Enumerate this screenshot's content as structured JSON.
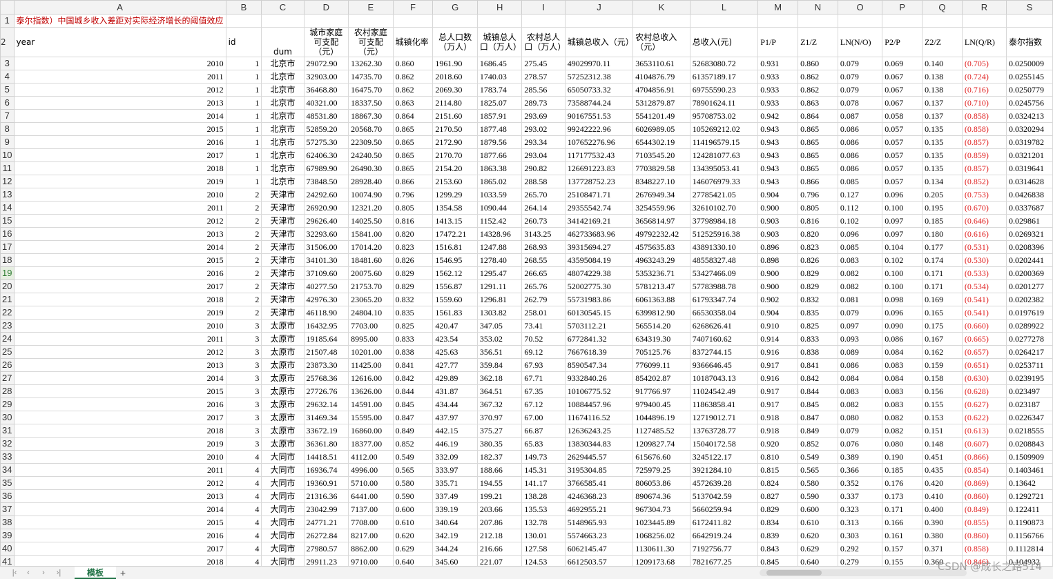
{
  "columns": [
    "A",
    "B",
    "C",
    "D",
    "E",
    "F",
    "G",
    "H",
    "I",
    "J",
    "K",
    "L",
    "M",
    "N",
    "O",
    "P",
    "Q",
    "R",
    "S"
  ],
  "title": "泰尔指数）中国城乡收入差距对实际经济增长的阈值效应",
  "headers": [
    "year",
    "id",
    "dum",
    "城市家庭可支配（元）",
    "农村家庭可支配（元）",
    "城镇化率",
    "总人口数（万人）",
    "城镇总人口（万人）",
    "农村总人口（万人）",
    "城镇总收入（元）",
    "农村总收入（元）",
    "总收入(元)",
    "P1/P",
    "Z1/Z",
    "LN(N/O)",
    "P2/P",
    "Z2/Z",
    "LN(Q/R)",
    "泰尔指数"
  ],
  "rows": [
    [
      "2010",
      "1",
      "北京市",
      "29072.90",
      "13262.30",
      "0.860",
      "1961.90",
      "1686.45",
      "275.45",
      "49029970.11",
      "3653110.61",
      "52683080.72",
      "0.931",
      "0.860",
      "0.079",
      "0.069",
      "0.140",
      "(0.705)",
      "0.0250009"
    ],
    [
      "2011",
      "1",
      "北京市",
      "32903.00",
      "14735.70",
      "0.862",
      "2018.60",
      "1740.03",
      "278.57",
      "57252312.38",
      "4104876.79",
      "61357189.17",
      "0.933",
      "0.862",
      "0.079",
      "0.067",
      "0.138",
      "(0.724)",
      "0.0255145"
    ],
    [
      "2012",
      "1",
      "北京市",
      "36468.80",
      "16475.70",
      "0.862",
      "2069.30",
      "1783.74",
      "285.56",
      "65050733.32",
      "4704856.91",
      "69755590.23",
      "0.933",
      "0.862",
      "0.079",
      "0.067",
      "0.138",
      "(0.716)",
      "0.0250779"
    ],
    [
      "2013",
      "1",
      "北京市",
      "40321.00",
      "18337.50",
      "0.863",
      "2114.80",
      "1825.07",
      "289.73",
      "73588744.24",
      "5312879.87",
      "78901624.11",
      "0.933",
      "0.863",
      "0.078",
      "0.067",
      "0.137",
      "(0.710)",
      "0.0245756"
    ],
    [
      "2014",
      "1",
      "北京市",
      "48531.80",
      "18867.30",
      "0.864",
      "2151.60",
      "1857.91",
      "293.69",
      "90167551.53",
      "5541201.49",
      "95708753.02",
      "0.942",
      "0.864",
      "0.087",
      "0.058",
      "0.137",
      "(0.858)",
      "0.0324213"
    ],
    [
      "2015",
      "1",
      "北京市",
      "52859.20",
      "20568.70",
      "0.865",
      "2170.50",
      "1877.48",
      "293.02",
      "99242222.96",
      "6026989.05",
      "105269212.02",
      "0.943",
      "0.865",
      "0.086",
      "0.057",
      "0.135",
      "(0.858)",
      "0.0320294"
    ],
    [
      "2016",
      "1",
      "北京市",
      "57275.30",
      "22309.50",
      "0.865",
      "2172.90",
      "1879.56",
      "293.34",
      "107652276.96",
      "6544302.19",
      "114196579.15",
      "0.943",
      "0.865",
      "0.086",
      "0.057",
      "0.135",
      "(0.857)",
      "0.0319782"
    ],
    [
      "2017",
      "1",
      "北京市",
      "62406.30",
      "24240.50",
      "0.865",
      "2170.70",
      "1877.66",
      "293.04",
      "117177532.43",
      "7103545.20",
      "124281077.63",
      "0.943",
      "0.865",
      "0.086",
      "0.057",
      "0.135",
      "(0.859)",
      "0.0321201"
    ],
    [
      "2018",
      "1",
      "北京市",
      "67989.90",
      "26490.30",
      "0.865",
      "2154.20",
      "1863.38",
      "290.82",
      "126691223.83",
      "7703829.58",
      "134395053.41",
      "0.943",
      "0.865",
      "0.086",
      "0.057",
      "0.135",
      "(0.857)",
      "0.0319641"
    ],
    [
      "2019",
      "1",
      "北京市",
      "73848.50",
      "28928.40",
      "0.866",
      "2153.60",
      "1865.02",
      "288.58",
      "137728752.23",
      "8348227.10",
      "146076979.33",
      "0.943",
      "0.866",
      "0.085",
      "0.057",
      "0.134",
      "(0.852)",
      "0.0314628"
    ],
    [
      "2010",
      "2",
      "天津市",
      "24292.60",
      "10074.90",
      "0.796",
      "1299.29",
      "1033.59",
      "265.70",
      "25108471.71",
      "2676949.34",
      "27785421.05",
      "0.904",
      "0.796",
      "0.127",
      "0.096",
      "0.205",
      "(0.753)",
      "0.0426838"
    ],
    [
      "2011",
      "2",
      "天津市",
      "26920.90",
      "12321.20",
      "0.805",
      "1354.58",
      "1090.44",
      "264.14",
      "29355542.74",
      "3254559.96",
      "32610102.70",
      "0.900",
      "0.805",
      "0.112",
      "0.100",
      "0.195",
      "(0.670)",
      "0.0337687"
    ],
    [
      "2012",
      "2",
      "天津市",
      "29626.40",
      "14025.50",
      "0.816",
      "1413.15",
      "1152.42",
      "260.73",
      "34142169.21",
      "3656814.97",
      "37798984.18",
      "0.903",
      "0.816",
      "0.102",
      "0.097",
      "0.185",
      "(0.646)",
      "0.029861"
    ],
    [
      "2013",
      "2",
      "天津市",
      "32293.60",
      "15841.00",
      "0.820",
      "17472.21",
      "14328.96",
      "3143.25",
      "462733683.96",
      "49792232.42",
      "512525916.38",
      "0.903",
      "0.820",
      "0.096",
      "0.097",
      "0.180",
      "(0.616)",
      "0.0269321"
    ],
    [
      "2014",
      "2",
      "天津市",
      "31506.00",
      "17014.20",
      "0.823",
      "1516.81",
      "1247.88",
      "268.93",
      "39315694.27",
      "4575635.83",
      "43891330.10",
      "0.896",
      "0.823",
      "0.085",
      "0.104",
      "0.177",
      "(0.531)",
      "0.0208396"
    ],
    [
      "2015",
      "2",
      "天津市",
      "34101.30",
      "18481.60",
      "0.826",
      "1546.95",
      "1278.40",
      "268.55",
      "43595084.19",
      "4963243.29",
      "48558327.48",
      "0.898",
      "0.826",
      "0.083",
      "0.102",
      "0.174",
      "(0.530)",
      "0.0202441"
    ],
    [
      "2016",
      "2",
      "天津市",
      "37109.60",
      "20075.60",
      "0.829",
      "1562.12",
      "1295.47",
      "266.65",
      "48074229.38",
      "5353236.71",
      "53427466.09",
      "0.900",
      "0.829",
      "0.082",
      "0.100",
      "0.171",
      "(0.533)",
      "0.0200369"
    ],
    [
      "2017",
      "2",
      "天津市",
      "40277.50",
      "21753.70",
      "0.829",
      "1556.87",
      "1291.11",
      "265.76",
      "52002775.30",
      "5781213.47",
      "57783988.78",
      "0.900",
      "0.829",
      "0.082",
      "0.100",
      "0.171",
      "(0.534)",
      "0.0201277"
    ],
    [
      "2018",
      "2",
      "天津市",
      "42976.30",
      "23065.20",
      "0.832",
      "1559.60",
      "1296.81",
      "262.79",
      "55731983.86",
      "6061363.88",
      "61793347.74",
      "0.902",
      "0.832",
      "0.081",
      "0.098",
      "0.169",
      "(0.541)",
      "0.0202382"
    ],
    [
      "2019",
      "2",
      "天津市",
      "46118.90",
      "24804.10",
      "0.835",
      "1561.83",
      "1303.82",
      "258.01",
      "60130545.15",
      "6399812.90",
      "66530358.04",
      "0.904",
      "0.835",
      "0.079",
      "0.096",
      "0.165",
      "(0.541)",
      "0.0197619"
    ],
    [
      "2010",
      "3",
      "太原市",
      "16432.95",
      "7703.00",
      "0.825",
      "420.47",
      "347.05",
      "73.41",
      "5703112.21",
      "565514.20",
      "6268626.41",
      "0.910",
      "0.825",
      "0.097",
      "0.090",
      "0.175",
      "(0.660)",
      "0.0289922"
    ],
    [
      "2011",
      "3",
      "太原市",
      "19185.64",
      "8995.00",
      "0.833",
      "423.54",
      "353.02",
      "70.52",
      "6772841.32",
      "634319.30",
      "7407160.62",
      "0.914",
      "0.833",
      "0.093",
      "0.086",
      "0.167",
      "(0.665)",
      "0.0277278"
    ],
    [
      "2012",
      "3",
      "太原市",
      "21507.48",
      "10201.00",
      "0.838",
      "425.63",
      "356.51",
      "69.12",
      "7667618.39",
      "705125.76",
      "8372744.15",
      "0.916",
      "0.838",
      "0.089",
      "0.084",
      "0.162",
      "(0.657)",
      "0.0264217"
    ],
    [
      "2013",
      "3",
      "太原市",
      "23873.30",
      "11425.00",
      "0.841",
      "427.77",
      "359.84",
      "67.93",
      "8590547.34",
      "776099.11",
      "9366646.45",
      "0.917",
      "0.841",
      "0.086",
      "0.083",
      "0.159",
      "(0.651)",
      "0.0253711"
    ],
    [
      "2014",
      "3",
      "太原市",
      "25768.36",
      "12616.00",
      "0.842",
      "429.89",
      "362.18",
      "67.71",
      "9332840.26",
      "854202.87",
      "10187043.13",
      "0.916",
      "0.842",
      "0.084",
      "0.084",
      "0.158",
      "(0.630)",
      "0.0239195"
    ],
    [
      "2015",
      "3",
      "太原市",
      "27726.76",
      "13626.00",
      "0.844",
      "431.87",
      "364.51",
      "67.35",
      "10106775.52",
      "917766.97",
      "11024542.49",
      "0.917",
      "0.844",
      "0.083",
      "0.083",
      "0.156",
      "(0.628)",
      "0.023497"
    ],
    [
      "2016",
      "3",
      "太原市",
      "29632.14",
      "14591.00",
      "0.845",
      "434.44",
      "367.32",
      "67.12",
      "10884457.96",
      "979400.45",
      "11863858.41",
      "0.917",
      "0.845",
      "0.082",
      "0.083",
      "0.155",
      "(0.627)",
      "0.023187"
    ],
    [
      "2017",
      "3",
      "太原市",
      "31469.34",
      "15595.00",
      "0.847",
      "437.97",
      "370.97",
      "67.00",
      "11674116.52",
      "1044896.19",
      "12719012.71",
      "0.918",
      "0.847",
      "0.080",
      "0.082",
      "0.153",
      "(0.622)",
      "0.0226347"
    ],
    [
      "2018",
      "3",
      "太原市",
      "33672.19",
      "16860.00",
      "0.849",
      "442.15",
      "375.27",
      "66.87",
      "12636243.25",
      "1127485.52",
      "13763728.77",
      "0.918",
      "0.849",
      "0.079",
      "0.082",
      "0.151",
      "(0.613)",
      "0.0218555"
    ],
    [
      "2019",
      "3",
      "太原市",
      "36361.80",
      "18377.00",
      "0.852",
      "446.19",
      "380.35",
      "65.83",
      "13830344.83",
      "1209827.74",
      "15040172.58",
      "0.920",
      "0.852",
      "0.076",
      "0.080",
      "0.148",
      "(0.607)",
      "0.0208843"
    ],
    [
      "2010",
      "4",
      "大同市",
      "14418.51",
      "4112.00",
      "0.549",
      "332.09",
      "182.37",
      "149.73",
      "2629445.57",
      "615676.60",
      "3245122.17",
      "0.810",
      "0.549",
      "0.389",
      "0.190",
      "0.451",
      "(0.866)",
      "0.1509909"
    ],
    [
      "2011",
      "4",
      "大同市",
      "16936.74",
      "4996.00",
      "0.565",
      "333.97",
      "188.66",
      "145.31",
      "3195304.85",
      "725979.25",
      "3921284.10",
      "0.815",
      "0.565",
      "0.366",
      "0.185",
      "0.435",
      "(0.854)",
      "0.1403461"
    ],
    [
      "2012",
      "4",
      "大同市",
      "19360.91",
      "5710.00",
      "0.580",
      "335.71",
      "194.55",
      "141.17",
      "3766585.41",
      "806053.86",
      "4572639.28",
      "0.824",
      "0.580",
      "0.352",
      "0.176",
      "0.420",
      "(0.869)",
      "0.13642"
    ],
    [
      "2013",
      "4",
      "大同市",
      "21316.36",
      "6441.00",
      "0.590",
      "337.49",
      "199.21",
      "138.28",
      "4246368.23",
      "890674.36",
      "5137042.59",
      "0.827",
      "0.590",
      "0.337",
      "0.173",
      "0.410",
      "(0.860)",
      "0.1292721"
    ],
    [
      "2014",
      "4",
      "大同市",
      "23042.99",
      "7137.00",
      "0.600",
      "339.19",
      "203.66",
      "135.53",
      "4692955.21",
      "967304.73",
      "5660259.94",
      "0.829",
      "0.600",
      "0.323",
      "0.171",
      "0.400",
      "(0.849)",
      "0.122411"
    ],
    [
      "2015",
      "4",
      "大同市",
      "24771.21",
      "7708.00",
      "0.610",
      "340.64",
      "207.86",
      "132.78",
      "5148965.93",
      "1023445.89",
      "6172411.82",
      "0.834",
      "0.610",
      "0.313",
      "0.166",
      "0.390",
      "(0.855)",
      "0.1190873"
    ],
    [
      "2016",
      "4",
      "大同市",
      "26272.84",
      "8217.00",
      "0.620",
      "342.19",
      "212.18",
      "130.01",
      "5574663.23",
      "1068256.02",
      "6642919.24",
      "0.839",
      "0.620",
      "0.303",
      "0.161",
      "0.380",
      "(0.860)",
      "0.1156766"
    ],
    [
      "2017",
      "4",
      "大同市",
      "27980.57",
      "8862.00",
      "0.629",
      "344.24",
      "216.66",
      "127.58",
      "6062145.47",
      "1130611.30",
      "7192756.77",
      "0.843",
      "0.629",
      "0.292",
      "0.157",
      "0.371",
      "(0.858)",
      "0.1112814"
    ],
    [
      "2018",
      "4",
      "大同市",
      "29911.23",
      "9710.00",
      "0.640",
      "345.60",
      "221.07",
      "124.53",
      "6612503.57",
      "1209173.68",
      "7821677.25",
      "0.845",
      "0.640",
      "0.279",
      "0.155",
      "0.360",
      "(0.846)",
      "0.104932"
    ]
  ],
  "selected_row": 19,
  "sheet_tabs": [
    "模板"
  ],
  "nav_icons": [
    "first-sheet-icon",
    "prev-sheet-icon",
    "next-sheet-icon",
    "last-sheet-icon"
  ],
  "add_sheet_label": "+",
  "watermark": "CSDN @成长之路514",
  "colors": {
    "negative": "#e02020",
    "title": "#c00000",
    "accent": "#217346"
  }
}
